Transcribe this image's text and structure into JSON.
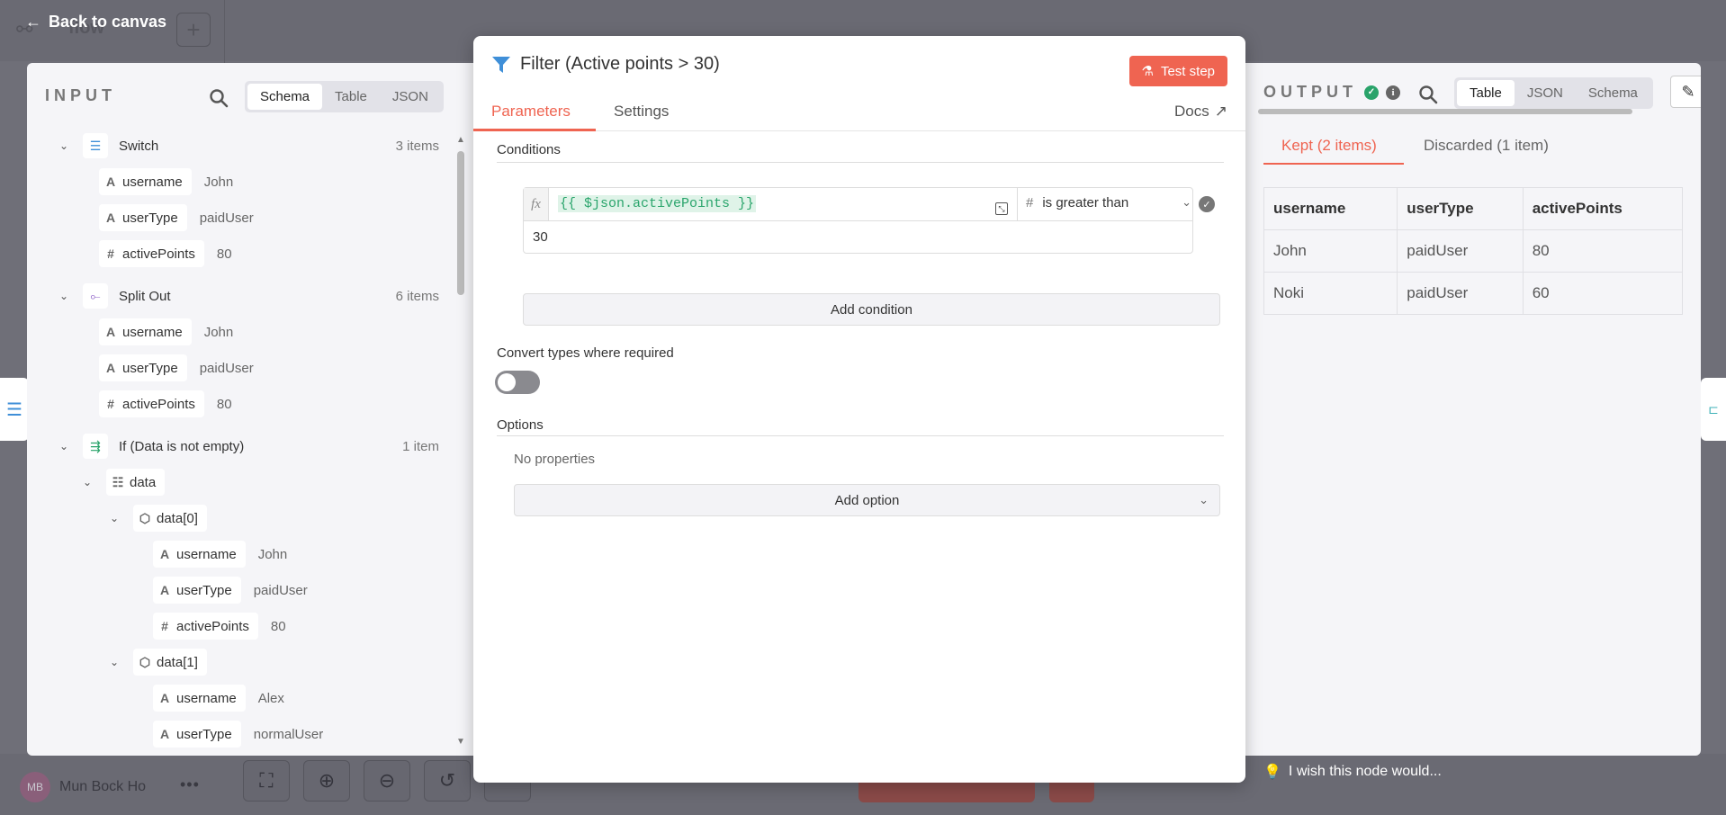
{
  "background": {
    "back_label": "Back to canvas",
    "workflow_title": "flow",
    "user_initials": "MB",
    "user_name": "Mun Bock Ho",
    "wish_label": "I wish this node would..."
  },
  "input": {
    "title": "INPUT",
    "tabs": [
      "Schema",
      "Table",
      "JSON"
    ],
    "active_tab": "Schema",
    "tree": [
      {
        "node": "Switch",
        "count": "3 items",
        "icon": "switch-icon",
        "color": "#3f8fd8"
      },
      {
        "key": "username",
        "type": "A",
        "value": "John"
      },
      {
        "key": "userType",
        "type": "A",
        "value": "paidUser"
      },
      {
        "key": "activePoints",
        "type": "#",
        "value": "80"
      },
      {
        "node": "Split Out",
        "count": "6 items",
        "icon": "split-out-icon",
        "color": "#8b5cc6"
      },
      {
        "key": "username",
        "type": "A",
        "value": "John"
      },
      {
        "key": "userType",
        "type": "A",
        "value": "paidUser"
      },
      {
        "key": "activePoints",
        "type": "#",
        "value": "80"
      },
      {
        "node": "If (Data is not empty)",
        "count": "1 item",
        "icon": "if-icon",
        "color": "#29a36a"
      },
      {
        "obj": "data",
        "icon": "list-icon"
      },
      {
        "obj": "data[0]",
        "icon": "cube-icon"
      },
      {
        "key": "username",
        "type": "A",
        "value": "John"
      },
      {
        "key": "userType",
        "type": "A",
        "value": "paidUser"
      },
      {
        "key": "activePoints",
        "type": "#",
        "value": "80"
      },
      {
        "obj": "data[1]",
        "icon": "cube-icon"
      },
      {
        "key": "username",
        "type": "A",
        "value": "Alex"
      },
      {
        "key": "userType",
        "type": "A",
        "value": "normalUser"
      }
    ]
  },
  "node": {
    "title": "Filter (Active points > 30)",
    "test_label": "Test step",
    "tabs": [
      "Parameters",
      "Settings"
    ],
    "active_tab": "Parameters",
    "docs_label": "Docs",
    "conditions_label": "Conditions",
    "condition": {
      "fx": "fx",
      "left_value": "{{ $json.activePoints }}",
      "operator": "is greater than",
      "operator_type": "#",
      "right_value": "30"
    },
    "add_condition_label": "Add condition",
    "convert_types_label": "Convert types where required",
    "convert_types_enabled": false,
    "options_label": "Options",
    "no_properties_label": "No properties",
    "add_option_label": "Add option",
    "accent": "#ef6451"
  },
  "output": {
    "title": "OUTPUT",
    "tabs": [
      "Table",
      "JSON",
      "Schema"
    ],
    "active_tab": "Table",
    "kept_label": "Kept (2 items)",
    "discarded_label": "Discarded (1 item)",
    "columns": [
      "username",
      "userType",
      "activePoints"
    ],
    "rows": [
      [
        "John",
        "paidUser",
        "80"
      ],
      [
        "Noki",
        "paidUser",
        "60"
      ]
    ]
  }
}
